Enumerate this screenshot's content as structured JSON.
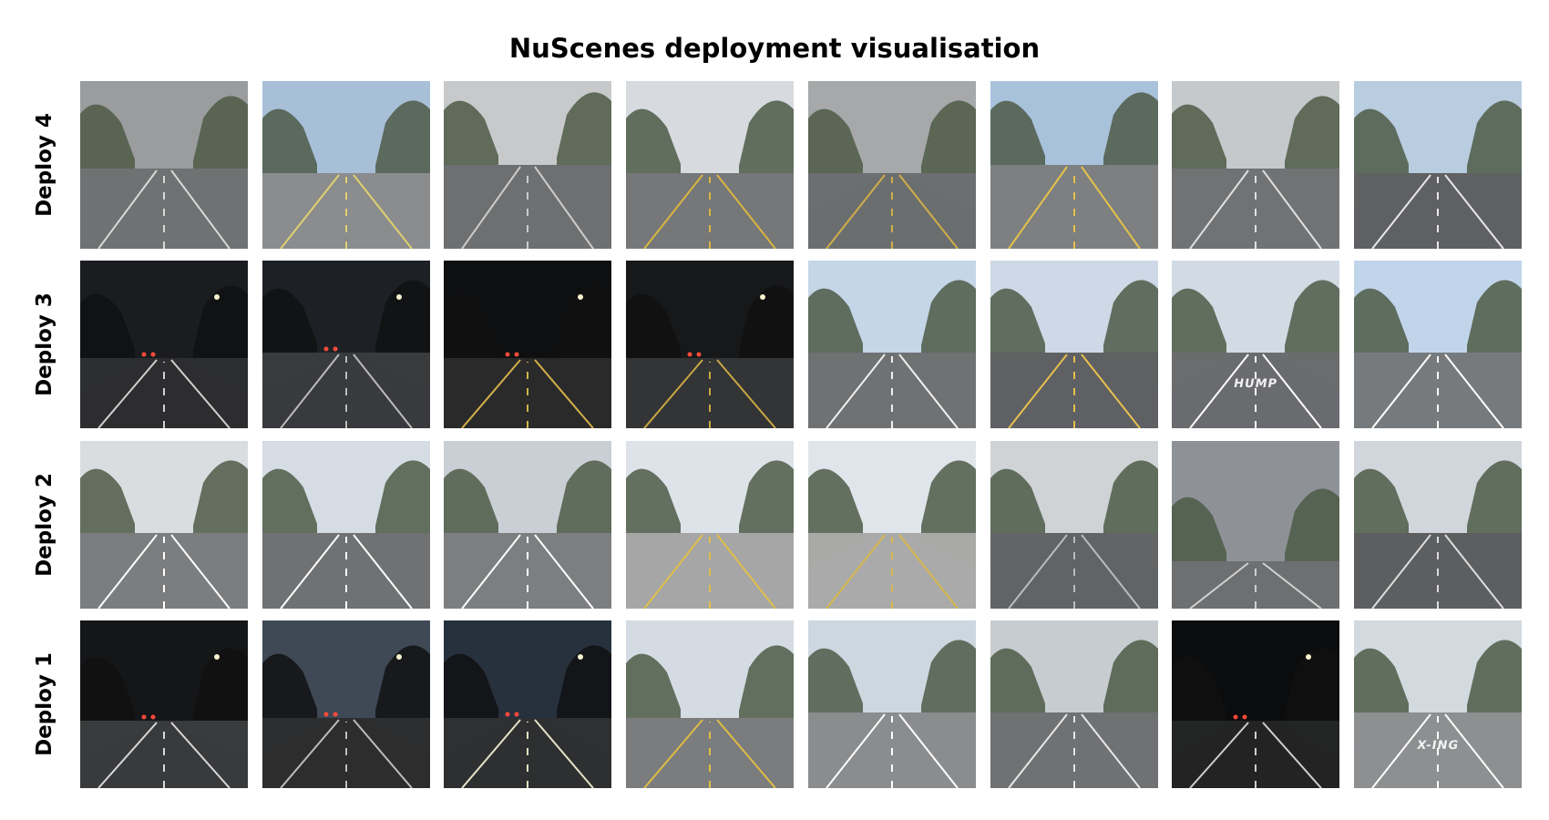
{
  "title": "NuScenes deployment visualisation",
  "rows": [
    {
      "label": "Deploy 4",
      "tiles": [
        {
          "sky": "#9a9c9d",
          "ground": "#6f7273",
          "lines": "#d8d8d8",
          "horizon": 0.52,
          "dark": false
        },
        {
          "sky": "#a8bfd8",
          "ground": "#8a8c8e",
          "lines": "#e0d070",
          "horizon": 0.55,
          "dark": false
        },
        {
          "sky": "#c7c9ca",
          "ground": "#6e6f70",
          "lines": "#cccccc",
          "horizon": 0.5,
          "dark": false
        },
        {
          "sky": "#d7dade",
          "ground": "#757779",
          "lines": "#d9b640",
          "horizon": 0.55,
          "dark": false
        },
        {
          "sky": "#a6a8a9",
          "ground": "#6c6e6f",
          "lines": "#cfae48",
          "horizon": 0.55,
          "dark": false
        },
        {
          "sky": "#a9c2db",
          "ground": "#7d7f81",
          "lines": "#e4c24a",
          "horizon": 0.5,
          "dark": false
        },
        {
          "sky": "#c6c9cb",
          "ground": "#707274",
          "lines": "#e0e0e0",
          "horizon": 0.52,
          "dark": false
        },
        {
          "sky": "#b9cde0",
          "ground": "#5f6163",
          "lines": "#e8e8e8",
          "horizon": 0.55,
          "dark": false
        }
      ]
    },
    {
      "label": "Deploy 3",
      "tiles": [
        {
          "sky": "#1a1c1f",
          "ground": "#2d2e30",
          "lines": "#d0d0d0",
          "horizon": 0.58,
          "dark": true
        },
        {
          "sky": "#1d2126",
          "ground": "#3a3b3d",
          "lines": "#bbbbbb",
          "horizon": 0.55,
          "dark": true
        },
        {
          "sky": "#0e0f10",
          "ground": "#2a2a2b",
          "lines": "#d3b04a",
          "horizon": 0.58,
          "dark": true
        },
        {
          "sky": "#16181a",
          "ground": "#333436",
          "lines": "#c9a843",
          "horizon": 0.58,
          "dark": true
        },
        {
          "sky": "#c4d6e8",
          "ground": "#6f7173",
          "lines": "#f0f0f0",
          "horizon": 0.55,
          "dark": false
        },
        {
          "sky": "#cdd9e6",
          "ground": "#5f6163",
          "lines": "#e6c04e",
          "horizon": 0.55,
          "dark": false
        },
        {
          "sky": "#d2dbe4",
          "ground": "#6a6c6e",
          "lines": "#ffffff",
          "horizon": 0.55,
          "dark": false
        },
        {
          "sky": "#c1d5ea",
          "ground": "#777a7c",
          "lines": "#ffffff",
          "horizon": 0.55,
          "dark": false
        }
      ]
    },
    {
      "label": "Deploy 2",
      "tiles": [
        {
          "sky": "#d9dde0",
          "ground": "#7b7d7f",
          "lines": "#ffffff",
          "horizon": 0.55,
          "dark": false
        },
        {
          "sky": "#d5dce3",
          "ground": "#6f7173",
          "lines": "#ffffff",
          "horizon": 0.55,
          "dark": false
        },
        {
          "sky": "#c9cfd4",
          "ground": "#7c7e80",
          "lines": "#ffffff",
          "horizon": 0.55,
          "dark": false
        },
        {
          "sky": "#dde3e8",
          "ground": "#a5a6a5",
          "lines": "#e0bf4a",
          "horizon": 0.55,
          "dark": false
        },
        {
          "sky": "#dfe5ea",
          "ground": "#a9aaa8",
          "lines": "#d6b84c",
          "horizon": 0.55,
          "dark": false
        },
        {
          "sky": "#cfd3d6",
          "ground": "#626466",
          "lines": "#bbbbbb",
          "horizon": 0.55,
          "dark": false
        },
        {
          "sky": "#8e9296",
          "ground": "#6d6f71",
          "lines": "#d0d0d0",
          "horizon": 0.72,
          "dark": false
        },
        {
          "sky": "#d0d6db",
          "ground": "#5c5e60",
          "lines": "#dddddd",
          "horizon": 0.55,
          "dark": false
        }
      ]
    },
    {
      "label": "Deploy 1",
      "tiles": [
        {
          "sky": "#141618",
          "ground": "#3a3b3c",
          "lines": "#d8d8d8",
          "horizon": 0.6,
          "dark": true
        },
        {
          "sky": "#3f4956",
          "ground": "#2d2e2f",
          "lines": "#bdbdbd",
          "horizon": 0.58,
          "dark": true
        },
        {
          "sky": "#27313d",
          "ground": "#2f3031",
          "lines": "#e7e2c8",
          "horizon": 0.58,
          "dark": true
        },
        {
          "sky": "#d4dbe2",
          "ground": "#7a7c7e",
          "lines": "#e0bd45",
          "horizon": 0.58,
          "dark": false
        },
        {
          "sky": "#cdd7e0",
          "ground": "#8a8c8e",
          "lines": "#ffffff",
          "horizon": 0.55,
          "dark": false
        },
        {
          "sky": "#c7ccd1",
          "ground": "#6f7173",
          "lines": "#e8e8e8",
          "horizon": 0.55,
          "dark": false
        },
        {
          "sky": "#0b0c0d",
          "ground": "#232424",
          "lines": "#cfcfcf",
          "horizon": 0.6,
          "dark": true
        },
        {
          "sky": "#d2d9df",
          "ground": "#8d8f91",
          "lines": "#ffffff",
          "horizon": 0.55,
          "dark": false
        }
      ]
    }
  ],
  "road_markings": {
    "deploy3_tile7": "HUMP",
    "deploy1_tile8": "X-ING"
  }
}
